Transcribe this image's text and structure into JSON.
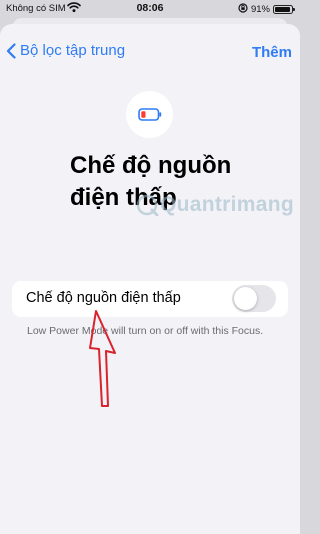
{
  "status_bar": {
    "carrier": "Không có SIM",
    "time": "08:06",
    "battery_percent": "91%",
    "battery_level": 0.91
  },
  "nav": {
    "back_label": "Bộ lọc tập trung",
    "add_label": "Thêm"
  },
  "header": {
    "icon": "low-battery-icon",
    "title": "Chế độ nguồn điện thấp"
  },
  "setting": {
    "label": "Chế độ nguồn điện thấp",
    "enabled": false,
    "footer": "Low Power Mode will turn on or off with this Focus."
  },
  "watermark": {
    "text": "Quantrimang"
  },
  "colors": {
    "accent": "#2f7cf6",
    "arrow": "#d9232d",
    "background": "#f2f2f7"
  }
}
